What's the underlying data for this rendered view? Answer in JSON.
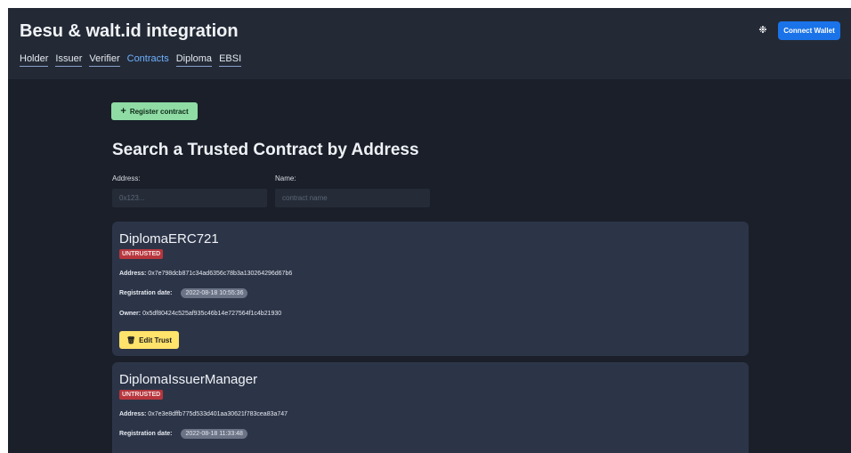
{
  "header": {
    "title": "Besu & walt.id integration",
    "connect_label": "Connect Wallet",
    "theme_icon": "❉",
    "nav": [
      {
        "label": "Holder"
      },
      {
        "label": "Issuer"
      },
      {
        "label": "Verifier"
      },
      {
        "label": "Contracts",
        "active": true
      },
      {
        "label": "Diploma"
      },
      {
        "label": "EBSI"
      }
    ]
  },
  "toolbar": {
    "register_label": "Register contract",
    "register_icon": "+"
  },
  "search": {
    "title": "Search a Trusted Contract by Address",
    "address_label": "Address:",
    "address_placeholder": "0x123...",
    "name_label": "Name:",
    "name_placeholder": "contract name"
  },
  "contracts": [
    {
      "name": "DiplomaERC721",
      "status": "UNTRUSTED",
      "address_label": "Address:",
      "address": "0x7e798dcb871c34ad6356c78b3a130264296d67b6",
      "registration_label": "Registration date:",
      "registration_date": "2022-08-18 10:55:36",
      "owner_label": "Owner:",
      "owner": "0x5df80424c525af935c46b14e727564f1c4b21930",
      "edit_label": "Edit Trust",
      "edit_icon": "🗑"
    },
    {
      "name": "DiplomaIssuerManager",
      "status": "UNTRUSTED",
      "address_label": "Address:",
      "address": "0x7e3e8dffb775d533d401aa30621f783cea83a747",
      "registration_label": "Registration date:",
      "registration_date": "2022-08-18 11:33:48"
    }
  ],
  "colors": {
    "page_bg": "#1a1f29",
    "header_bg": "#232a36",
    "card_bg": "#2c3548",
    "accent_blue": "#1a73e8",
    "success_green": "#8fdca5",
    "warning_yellow": "#ffe36b",
    "danger_red": "#b7363d"
  }
}
